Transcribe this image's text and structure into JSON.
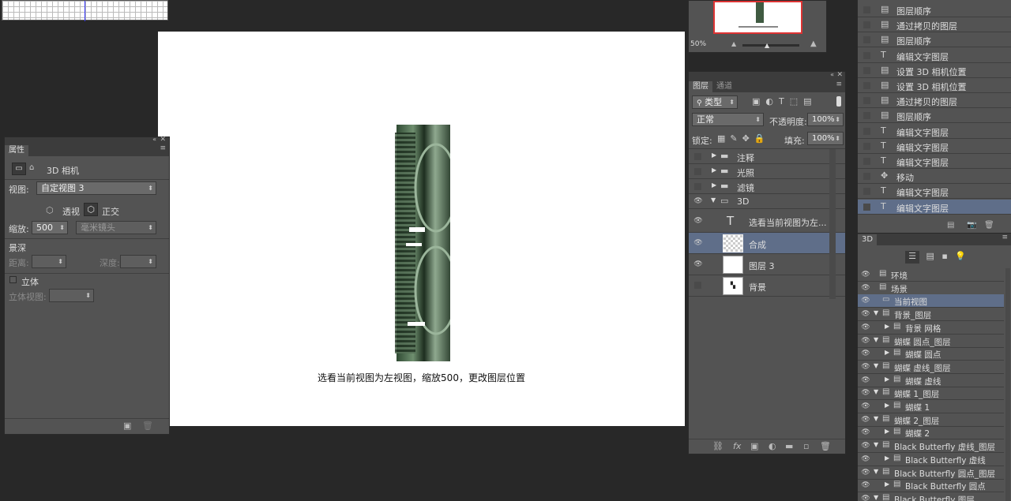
{
  "canvas": {
    "caption": "选看当前视图为左视图，缩放500，更改图层位置"
  },
  "props": {
    "tab": "属性",
    "camera_label": "3D 相机",
    "view_label": "视图:",
    "view_value": "自定视图 3",
    "persp": "透视",
    "ortho": "正交",
    "zoom_label": "缩放:",
    "zoom_value": "500",
    "lens_value": "毫米镜头",
    "dof_header": "景深",
    "dist_label": "距离:",
    "depth_label": "深度:",
    "stereo_label": "立体",
    "stereo_view_label": "立体视图:"
  },
  "navigator": {
    "zoom": "50%"
  },
  "layers": {
    "tabs": [
      "图层",
      "通道"
    ],
    "filter": "类型",
    "blend_mode": "正常",
    "opacity_label": "不透明度:",
    "opacity_value": "100%",
    "lock_label": "锁定:",
    "fill_label": "填充:",
    "fill_value": "100%",
    "items": [
      {
        "name": "注释"
      },
      {
        "name": "光照"
      },
      {
        "name": "滤镜"
      },
      {
        "name": "3D"
      },
      {
        "name": "选看当前视图为左..."
      },
      {
        "name": "合成"
      },
      {
        "name": "图层 3"
      },
      {
        "name": "背景"
      }
    ]
  },
  "history": {
    "items": [
      {
        "label": "图层顺序"
      },
      {
        "label": "通过拷贝的图层"
      },
      {
        "label": "图层顺序"
      },
      {
        "label": "编辑文字图层"
      },
      {
        "label": "设置 3D 相机位置"
      },
      {
        "label": "设置 3D 相机位置"
      },
      {
        "label": "通过拷贝的图层"
      },
      {
        "label": "图层顺序"
      },
      {
        "label": "编辑文字图层"
      },
      {
        "label": "编辑文字图层"
      },
      {
        "label": "编辑文字图层"
      },
      {
        "label": "移动"
      },
      {
        "label": "编辑文字图层"
      },
      {
        "label": "编辑文字图层"
      }
    ]
  },
  "panel3d": {
    "tab": "3D",
    "items": [
      {
        "label": "环境"
      },
      {
        "label": "场景"
      },
      {
        "label": "当前视图"
      },
      {
        "label": "背景_图层"
      },
      {
        "label": "背景 网格"
      },
      {
        "label": "蝴蝶 圆点_图层"
      },
      {
        "label": "蝴蝶 圆点"
      },
      {
        "label": "蝴蝶 虚线_图层"
      },
      {
        "label": "蝴蝶 虚线"
      },
      {
        "label": "蝴蝶 1_图层"
      },
      {
        "label": "蝴蝶 1"
      },
      {
        "label": "蝴蝶 2_图层"
      },
      {
        "label": "蝴蝶 2"
      },
      {
        "label": "Black Butterfly 虚线_图层"
      },
      {
        "label": "Black Butterfly 虚线"
      },
      {
        "label": "Black Butterfly 圆点_图层"
      },
      {
        "label": "Black Butterfly 圆点"
      },
      {
        "label": "Black Butterfly 图层"
      }
    ]
  }
}
